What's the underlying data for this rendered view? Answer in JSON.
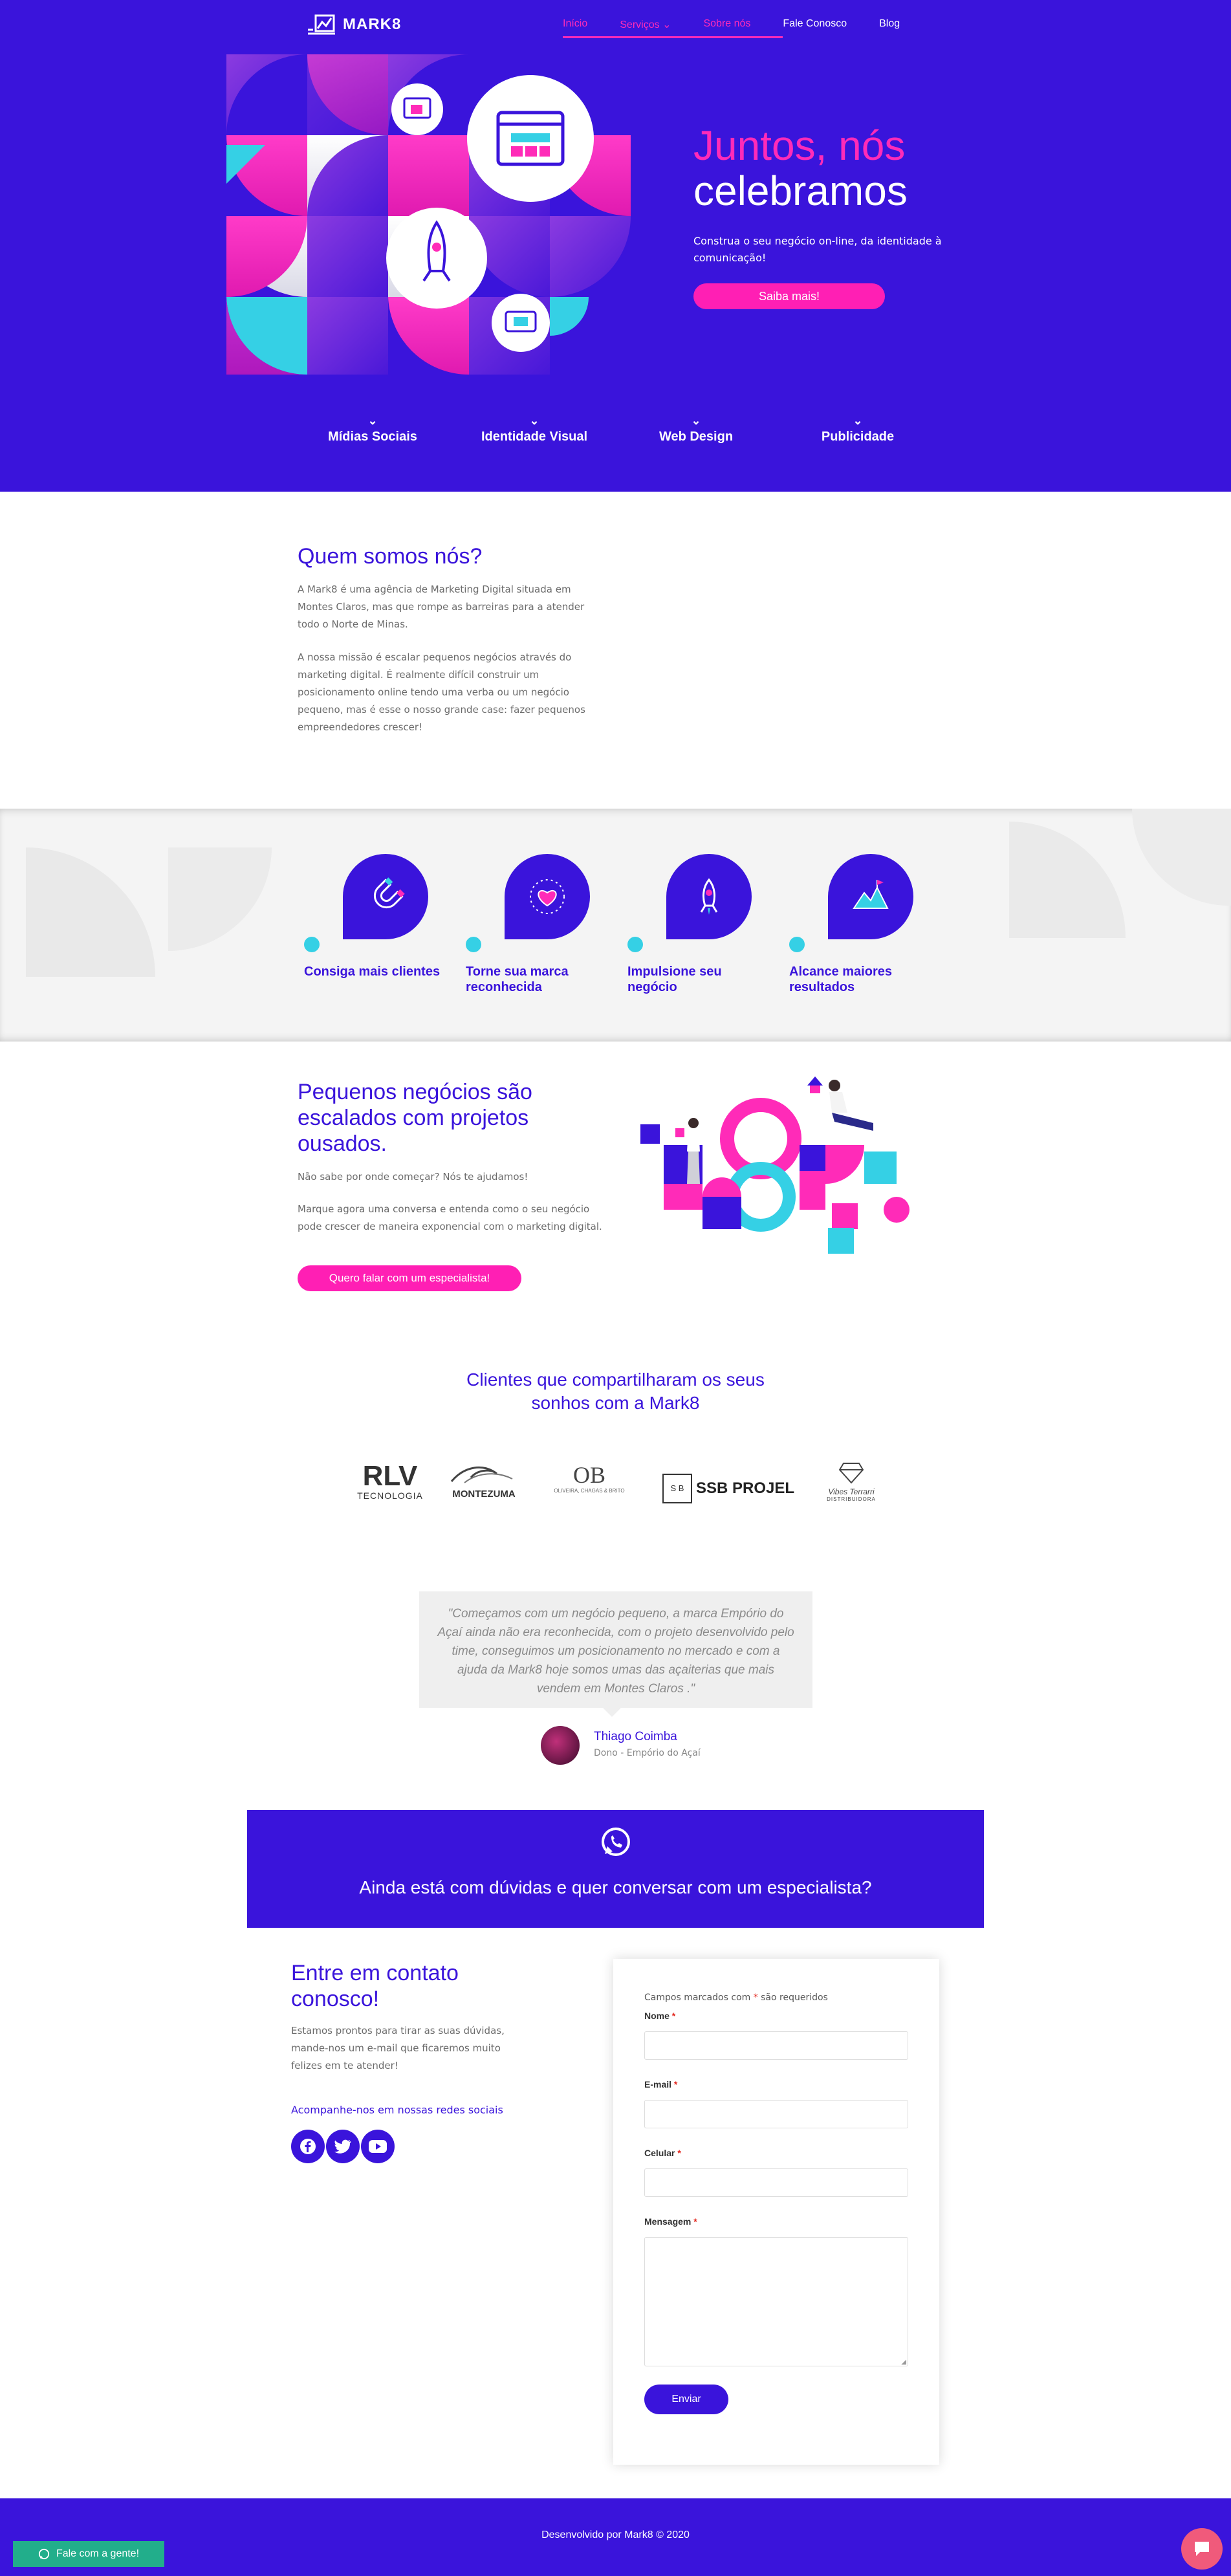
{
  "brand": {
    "name": "MARK8",
    "primary": "#3A14DB",
    "pink": "#FF2BB8",
    "cyan": "#35D0E5"
  },
  "nav": {
    "items": [
      {
        "label": "Início"
      },
      {
        "label": "Serviços"
      },
      {
        "label": "Sobre nós"
      },
      {
        "label": "Fale Conosco"
      },
      {
        "label": "Blog"
      }
    ]
  },
  "hero": {
    "title_line1": "Juntos, nós",
    "title_line2": "celebramos",
    "subtitle": "Construa o seu negócio on-line, da identidade à comunicação!",
    "button": "Saiba mais!"
  },
  "services": [
    "Mídias Sociais",
    "Identidade Visual",
    "Web Design",
    "Publicidade"
  ],
  "about": {
    "title": "Quem somos nós?",
    "p1": "A Mark8 é uma agência de Marketing Digital situada em Montes Claros, mas que rompe as barreiras para a atender todo o Norte de Minas.",
    "p2": "A nossa missão é escalar pequenos negócios através do marketing digital. É realmente difícil construir um posicionamento online tendo uma verba ou um negócio pequeno, mas é esse o nosso grande case: fazer pequenos empreendedores crescer!"
  },
  "features": [
    {
      "label": "Consiga mais clientes",
      "icon": "magnet-icon"
    },
    {
      "label": "Torne sua marca reconhecida",
      "icon": "heart-icon"
    },
    {
      "label": "Impulsione seu negócio",
      "icon": "rocket-icon"
    },
    {
      "label": "Alcance maiores resultados",
      "icon": "mountain-flag-icon"
    }
  ],
  "scale": {
    "title": "Pequenos negócios são escalados com projetos ousados.",
    "p1": "Não sabe por onde começar? Nós te ajudamos!",
    "p2": "Marque agora uma conversa e entenda como o seu negócio pode crescer de maneira exponencial com o marketing digital.",
    "button": "Quero falar com um especialista!"
  },
  "clients": {
    "title_line1": "Clientes que compartilharam os seus",
    "title_line2": "sonhos com a Mark8",
    "logos": [
      {
        "main": "RLV",
        "sub": "TECNOLOGIA"
      },
      {
        "main": "MONTEZUMA",
        "sub": ""
      },
      {
        "main": "OB",
        "sub": "OLIVEIRA, CHAGAS & BRITO"
      },
      {
        "main": "SSB PROJEL",
        "sub": ""
      },
      {
        "main": "Vibes Terrarri",
        "sub": "DISTRIBUIDORA"
      }
    ]
  },
  "testimonial": {
    "quote": "\"Começamos com um negócio pequeno, a marca Empório do Açaí ainda não era reconhecida, com o projeto desenvolvido pelo time, conseguimos um posicionamento no mercado e com a ajuda da Mark8 hoje somos umas das açaiterias que mais vendem em Montes Claros .\"",
    "name": "Thiago Coimba",
    "role": "Dono - Empório do Açaí"
  },
  "cta": {
    "text": "Ainda está com dúvidas e quer conversar com um especialista?"
  },
  "contact": {
    "title_line1": "Entre em contato",
    "title_line2": "conosco!",
    "text": "Estamos prontos para tirar as suas dúvidas, mande-nos um e-mail que ficaremos muito felizes em te atender!",
    "social_label": "Acompanhe-nos em nossas redes sociais",
    "required_note_pre": "Campos marcados com",
    "required_star": "*",
    "required_note_post": "são requeridos",
    "fields": [
      {
        "label": "Nome"
      },
      {
        "label": "E-mail"
      },
      {
        "label": "Celular"
      },
      {
        "label": "Mensagem"
      }
    ],
    "submit": "Enviar"
  },
  "footer": {
    "text": "Desenvolvido por Mark8 © 2020"
  },
  "whatsapp_button": "Fale com a gente!"
}
